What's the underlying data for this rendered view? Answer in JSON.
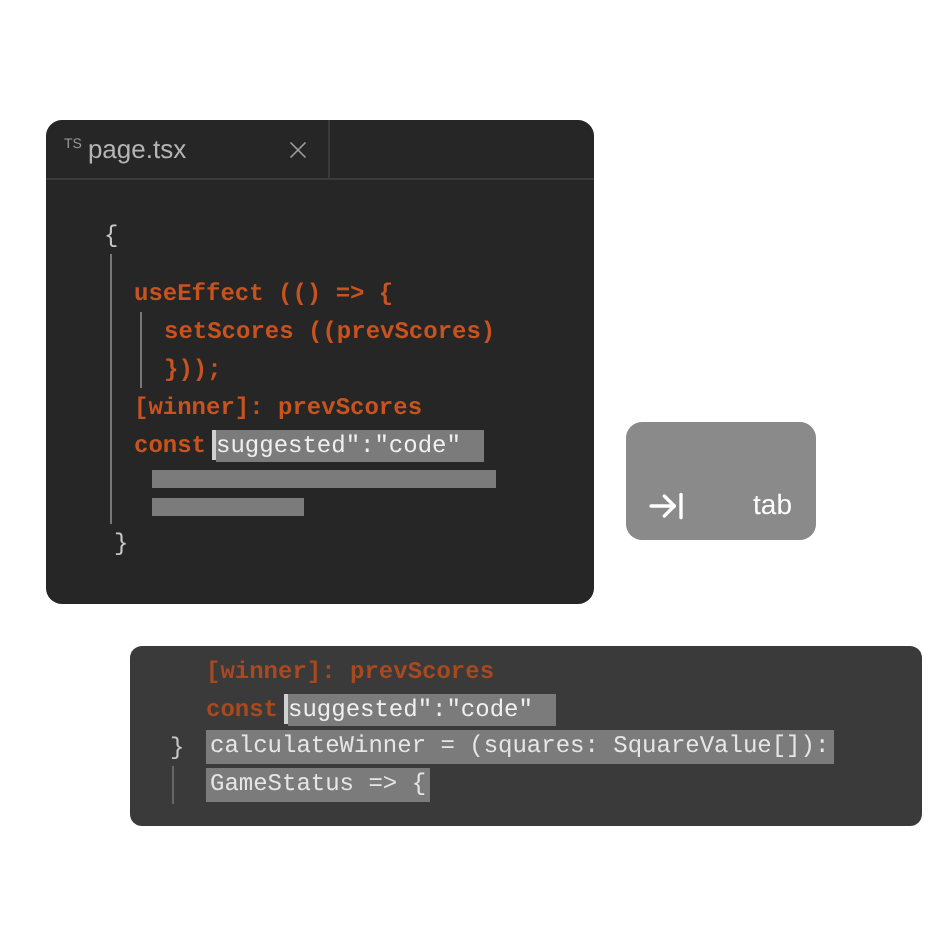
{
  "editor": {
    "tab": {
      "lang": "TS",
      "filename": "page.tsx"
    },
    "code": {
      "open": "{",
      "close": "}",
      "children": [
        {
          "kind": "code",
          "text": "useEffect (() => {",
          "children": [
            {
              "kind": "code",
              "text": "setScores ((prevScores)"
            },
            {
              "kind": "code",
              "text": "}));"
            }
          ]
        },
        {
          "kind": "code",
          "text": "[winner]: prevScores"
        },
        {
          "kind": "suggestion",
          "text": "const",
          "suggestion": "suggested\":\"code\""
        },
        {
          "kind": "skeleton"
        },
        {
          "kind": "skeleton"
        }
      ]
    }
  },
  "key": {
    "label": "tab"
  },
  "completion": {
    "lines": [
      {
        "kind": "code",
        "text": "[winner]: prevScores"
      },
      {
        "kind": "suggestion",
        "text": "const",
        "suggestion": "suggested\":\"code\""
      },
      {
        "kind": "selected",
        "prefix": "}",
        "text": "calculateWinner = (squares: SquareValue[]):"
      },
      {
        "kind": "selected",
        "text": "GameStatus => {"
      }
    ]
  }
}
